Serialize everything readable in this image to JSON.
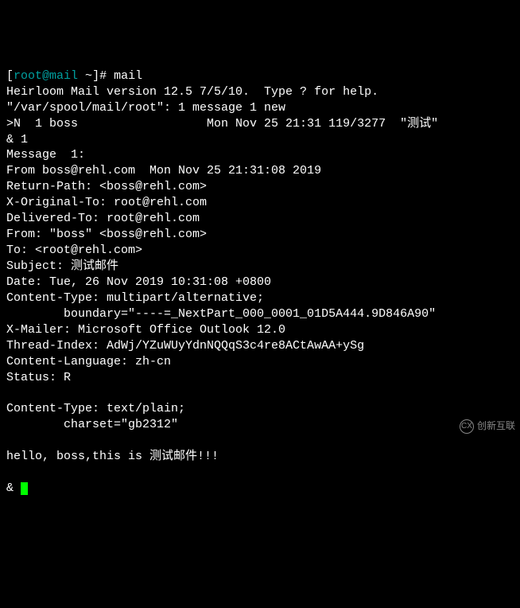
{
  "prompt_line": {
    "prefix": "[",
    "user": "root@mail",
    "cwd": "~",
    "suffix": "]#",
    "command": "mail"
  },
  "lines": [
    "Heirloom Mail version 12.5 7/5/10.  Type ? for help.",
    "\"/var/spool/mail/root\": 1 message 1 new",
    ">N  1 boss                  Mon Nov 25 21:31 119/3277  \"测试\"",
    "& 1",
    "Message  1:",
    "From boss@rehl.com  Mon Nov 25 21:31:08 2019",
    "Return-Path: <boss@rehl.com>",
    "X-Original-To: root@rehl.com",
    "Delivered-To: root@rehl.com",
    "From: \"boss\" <boss@rehl.com>",
    "To: <root@rehl.com>",
    "Subject: 测试邮件",
    "Date: Tue, 26 Nov 2019 10:31:08 +0800",
    "Content-Type: multipart/alternative;",
    "        boundary=\"----=_NextPart_000_0001_01D5A444.9D846A90\"",
    "X-Mailer: Microsoft Office Outlook 12.0",
    "Thread-Index: AdWj/YZuWUyYdnNQQqS3c4re8ACtAwAA+ySg",
    "Content-Language: zh-cn",
    "Status: R",
    "",
    "Content-Type: text/plain;",
    "        charset=\"gb2312\"",
    "",
    "hello, boss,this is 测试邮件!!!",
    ""
  ],
  "cursor_prefix": "& ",
  "watermark": "创新互联"
}
